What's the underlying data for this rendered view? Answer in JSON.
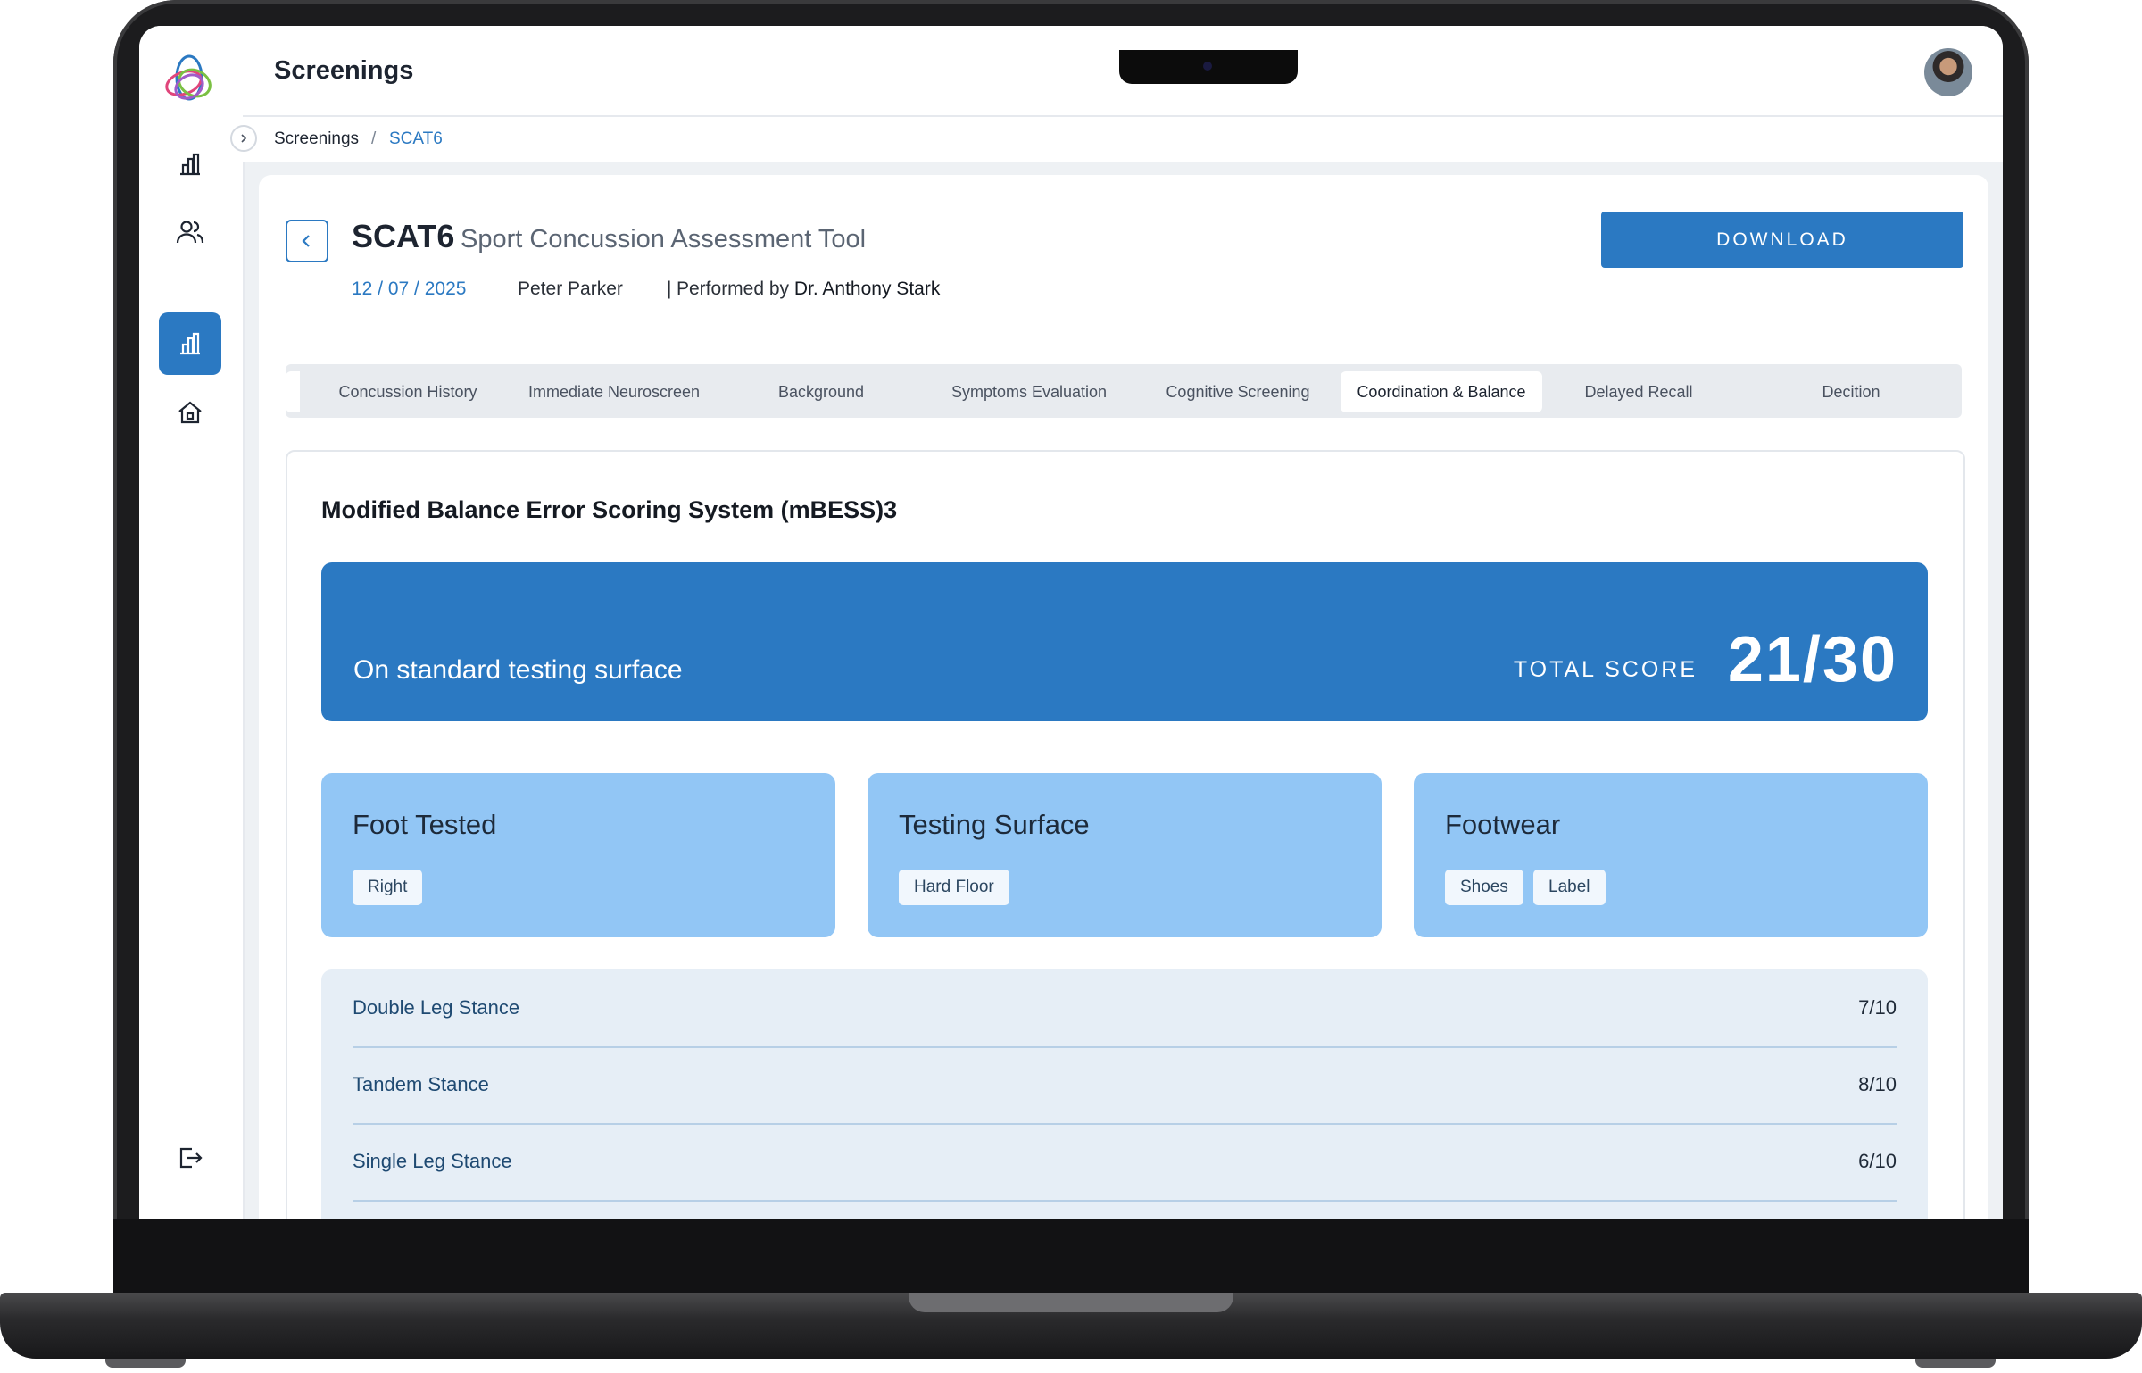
{
  "app": {
    "header_title": "Screenings",
    "breadcrumb": [
      "Screenings",
      "/",
      "SCAT6"
    ]
  },
  "sidebar": {
    "items": [
      {
        "icon": "bar-chart-icon",
        "active": false
      },
      {
        "icon": "users-icon",
        "active": false
      },
      {
        "icon": "bar-chart-icon",
        "active": true
      },
      {
        "icon": "home-icon",
        "active": false
      }
    ],
    "bottom_icon": "logout-icon"
  },
  "assessment": {
    "code": "SCAT6",
    "name": "Sport Concussion Assessment Tool",
    "date": "12 / 07 / 2025",
    "athlete": "Peter Parker",
    "separator": "|",
    "performed_by_label": "Performed by",
    "performed_by": "Dr. Anthony Stark",
    "download_label": "DOWNLOAD"
  },
  "tabs": [
    {
      "label": "Concussion History",
      "active": false
    },
    {
      "label": "Immediate Neuroscreen",
      "active": false
    },
    {
      "label": "Background",
      "active": false
    },
    {
      "label": "Symptoms Evaluation",
      "active": false
    },
    {
      "label": "Cognitive Screening",
      "active": false
    },
    {
      "label": "Coordination & Balance",
      "active": true
    },
    {
      "label": "Delayed Recall",
      "active": false
    },
    {
      "label": "Decition",
      "active": false
    }
  ],
  "section": {
    "title": "Modified Balance Error Scoring System (mBESS)3",
    "surface_text": "On standard testing surface",
    "total_score_label": "TOTAL SCORE",
    "total_score": "21/30"
  },
  "tiles": [
    {
      "label": "Foot Tested",
      "chips": [
        "Right"
      ]
    },
    {
      "label": "Testing Surface",
      "chips": [
        "Hard Floor"
      ]
    },
    {
      "label": "Footwear",
      "chips": [
        "Shoes",
        "Label"
      ]
    }
  ],
  "rows": [
    {
      "label": "Double Leg Stance",
      "value": "7/10"
    },
    {
      "label": "Tandem Stance",
      "value": "8/10"
    },
    {
      "label": "Single Leg Stance",
      "value": "6/10"
    }
  ],
  "colors": {
    "primary": "#2b79c2",
    "tile": "#92c6f5",
    "row_bg": "#e6eef6"
  }
}
